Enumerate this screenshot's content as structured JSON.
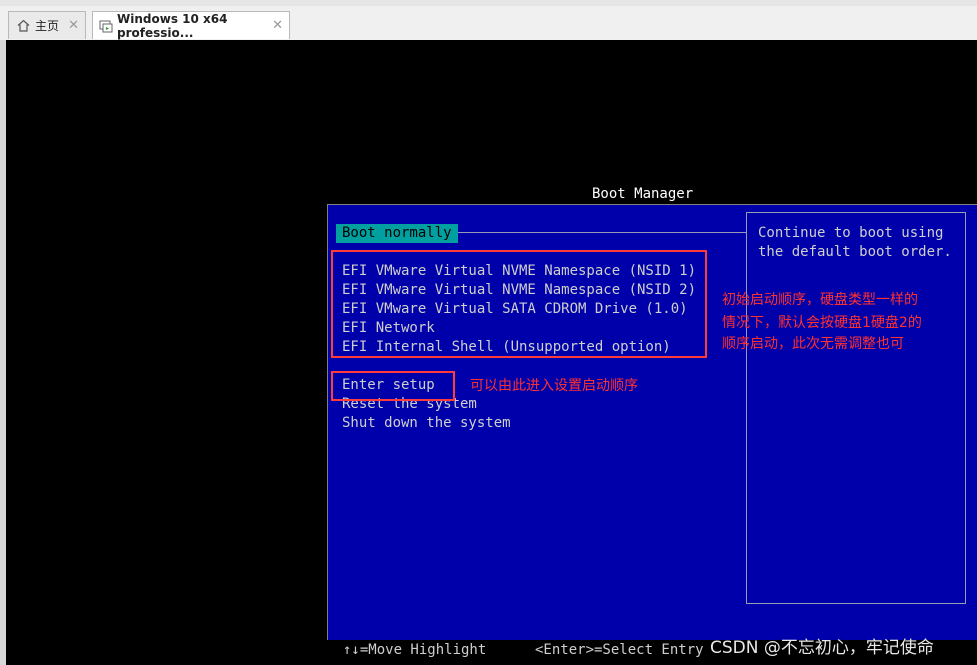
{
  "tabs": [
    {
      "label": "主页",
      "icon": "home-icon"
    },
    {
      "label": "Windows 10 x64 professio...",
      "icon": "vm-icon"
    }
  ],
  "boot": {
    "title": "Boot Manager",
    "selected": "Boot normally",
    "entries": [
      "EFI VMware Virtual NVME Namespace (NSID 1)",
      "EFI VMware Virtual NVME Namespace (NSID 2)",
      "EFI VMware Virtual SATA CDROM Drive (1.0)",
      "EFI Network",
      "EFI Internal Shell (Unsupported option)"
    ],
    "actions": [
      "Enter setup",
      "Reset the system",
      "Shut down the system"
    ],
    "help": [
      "Continue to boot using",
      "the default boot order."
    ],
    "footer": {
      "move": "↑↓=Move Highlight",
      "select": "<Enter>=Select Entry"
    }
  },
  "annotations": {
    "entries_note": [
      "初始启动顺序，硬盘类型一样的",
      "情况下，默认会按硬盘1硬盘2的",
      "顺序启动，此次无需调整也可"
    ],
    "setup_note": "可以由此进入设置启动顺序",
    "color": "#ff3030"
  },
  "watermark": "CSDN @不忘初心，牢记使命"
}
